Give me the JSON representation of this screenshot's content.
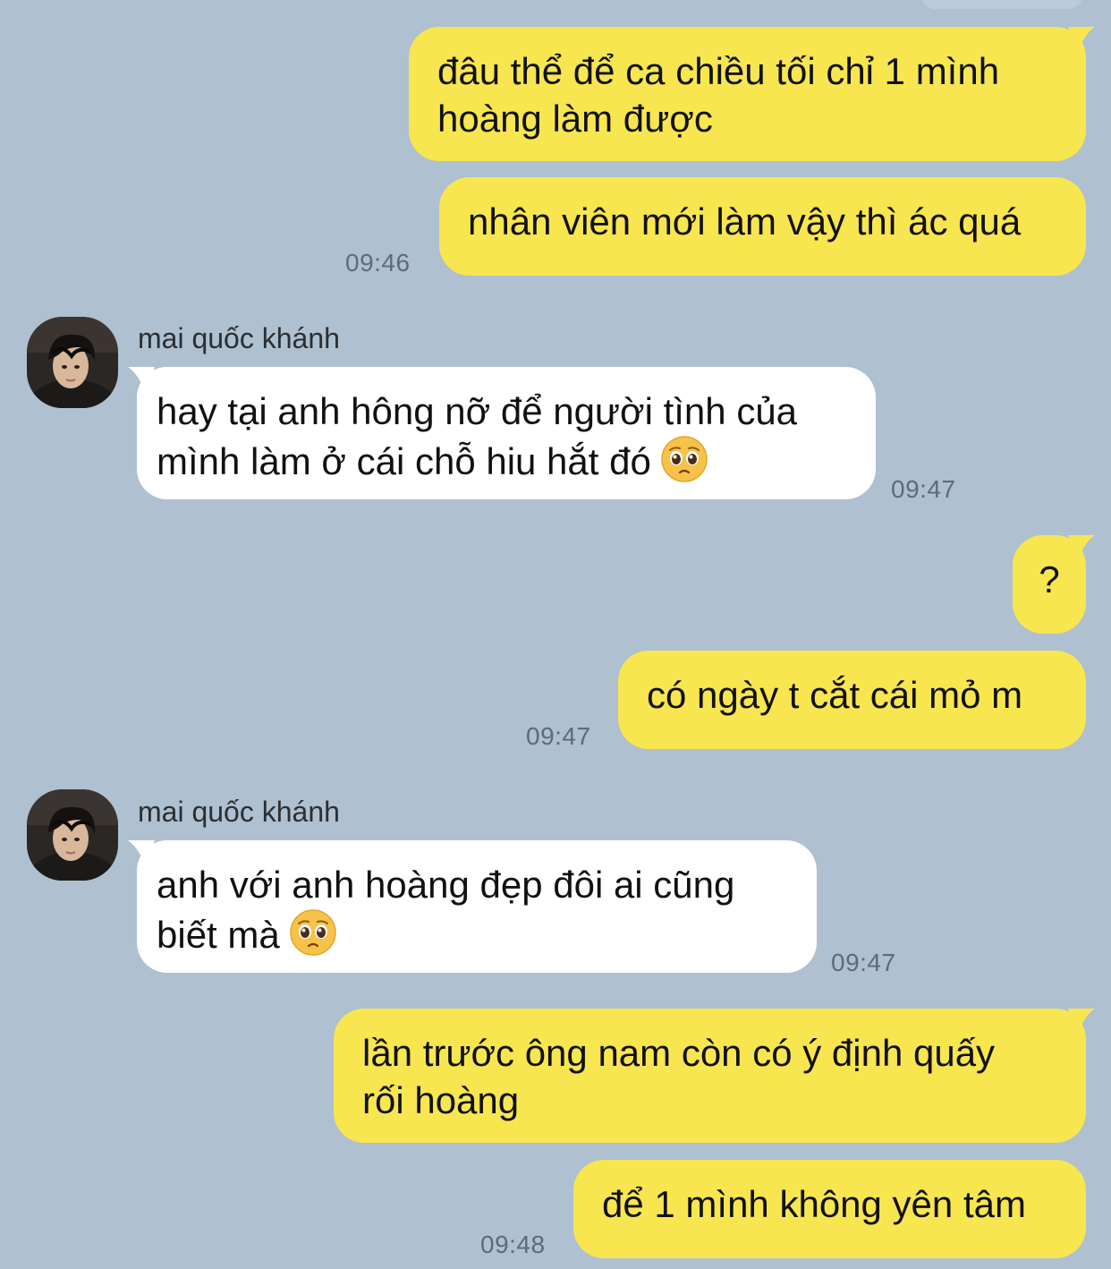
{
  "colors": {
    "background": "#afc0d0",
    "outgoing_bubble": "#f8e650",
    "incoming_bubble": "#ffffff",
    "timestamp": "#5e6b78"
  },
  "messages": [
    {
      "id": "m1",
      "direction": "out",
      "lines": [
        "đâu thể để ca chiều tối chỉ 1 mình",
        "hoàng làm được"
      ]
    },
    {
      "id": "m2",
      "direction": "out",
      "lines": [
        "nhân viên mới làm vậy thì ác quá"
      ],
      "time": "09:46"
    },
    {
      "id": "m3",
      "direction": "in",
      "sender": "mai quốc khánh",
      "avatar_icon": "profile-photo-icon",
      "lines": [
        "hay tại anh hông nỡ để người tình của",
        "mình làm ở cái chỗ hiu hắt đó"
      ],
      "emoji": "pleading-face-icon",
      "time": "09:47"
    },
    {
      "id": "m4",
      "direction": "out",
      "lines": [
        "?"
      ]
    },
    {
      "id": "m5",
      "direction": "out",
      "lines": [
        "có ngày t cắt cái mỏ m"
      ],
      "time": "09:47"
    },
    {
      "id": "m6",
      "direction": "in",
      "sender": "mai quốc khánh",
      "avatar_icon": "profile-photo-icon",
      "lines": [
        "anh với anh hoàng đẹp đôi ai cũng",
        "biết mà"
      ],
      "emoji": "pleading-face-icon",
      "time": "09:47"
    },
    {
      "id": "m7",
      "direction": "out",
      "lines": [
        "lần trước ông nam còn có ý định quấy",
        "rối hoàng"
      ]
    },
    {
      "id": "m8",
      "direction": "out",
      "lines": [
        "để 1 mình không yên tâm"
      ],
      "time": "09:48"
    }
  ]
}
